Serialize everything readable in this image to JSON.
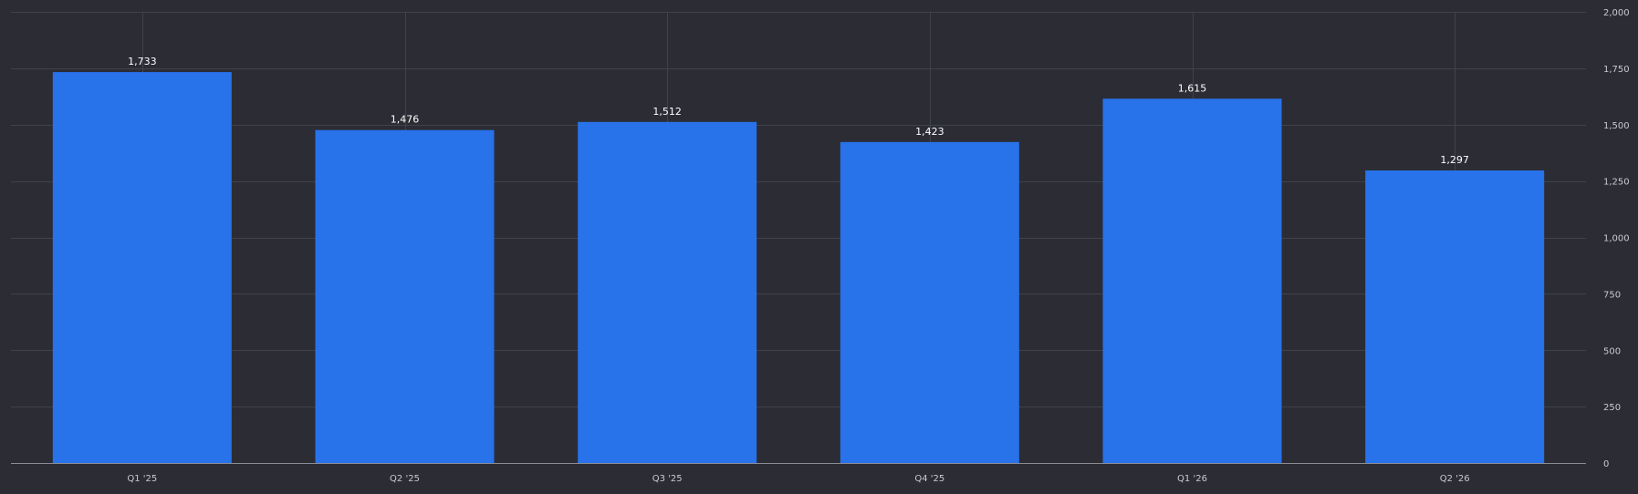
{
  "chart_data": {
    "type": "bar",
    "title": "",
    "xlabel": "",
    "ylabel": "",
    "categories": [
      "Q1 '25",
      "Q2 '25",
      "Q3 '25",
      "Q4 '25",
      "Q1 '26",
      "Q2 '26"
    ],
    "values": [
      1733,
      1476,
      1512,
      1423,
      1615,
      1297
    ],
    "value_labels": [
      "1,733",
      "1,476",
      "1,512",
      "1,423",
      "1,615",
      "1,297"
    ],
    "ylim": [
      0,
      2000
    ],
    "y_ticks": [
      0,
      250,
      500,
      750,
      1000,
      1250,
      1500,
      1750,
      2000
    ],
    "y_tick_labels": [
      "0",
      "250",
      "500",
      "750",
      "1,000",
      "1,250",
      "1,500",
      "1,750",
      "2,000"
    ],
    "y_axis_side": "right",
    "grid": true,
    "legend": "none"
  },
  "colors": {
    "background": "#2b2c34",
    "bar": "#2872ea",
    "grid": "#41434c",
    "axis": "#8a8c94",
    "tick_text": "#c9cad0",
    "value_text": "#ffffff"
  }
}
